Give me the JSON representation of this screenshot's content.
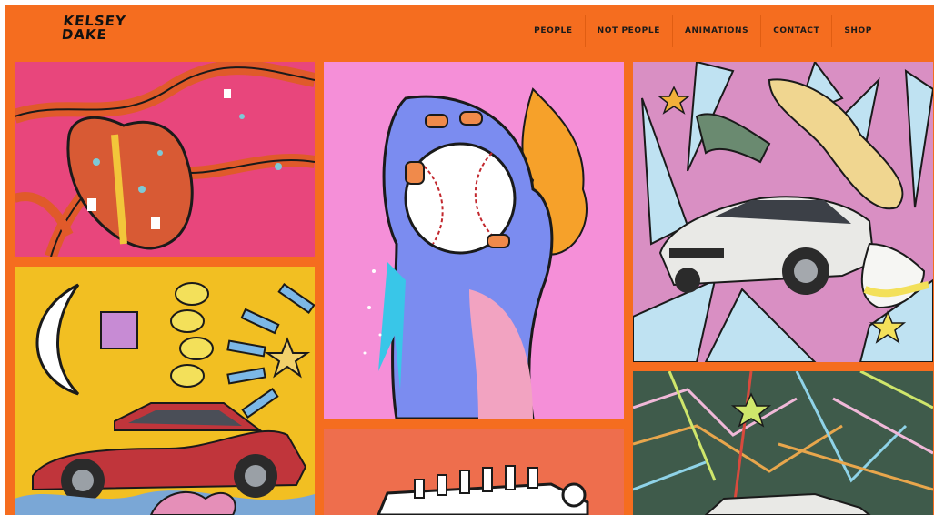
{
  "site": {
    "logo_line1": "KELSEY",
    "logo_line2": "DAKE"
  },
  "nav": {
    "items": [
      {
        "label": "PEOPLE"
      },
      {
        "label": "NOT PEOPLE"
      },
      {
        "label": "ANIMATIONS"
      },
      {
        "label": "CONTACT"
      },
      {
        "label": "SHOP"
      }
    ]
  },
  "colors": {
    "brand_orange": "#f56d1f",
    "tile_heart_bg": "#e8467c",
    "tile_baseball_bg": "#f58fd8",
    "tile_car_white_bg": "#d98fc3",
    "tile_car_red_bg": "#f2bf22",
    "tile_engine_bg": "#ee6e4d",
    "tile_green_bg": "#3f5b4b"
  },
  "gallery": {
    "tiles": [
      {
        "name": "anatomical-heart-illustration"
      },
      {
        "name": "baseball-hand-illustration"
      },
      {
        "name": "white-suv-shards-illustration"
      },
      {
        "name": "red-suv-moon-illustration"
      },
      {
        "name": "engine-illustration"
      },
      {
        "name": "green-lines-car-illustration"
      }
    ]
  }
}
